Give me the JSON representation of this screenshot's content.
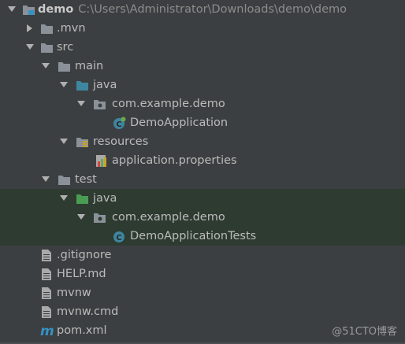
{
  "project": {
    "name": "demo",
    "path": "C:\\Users\\Administrator\\Downloads\\demo\\demo"
  },
  "tree": [
    {
      "label": "demo",
      "icon": "module-folder-icon",
      "expanded": true
    },
    {
      "label": ".mvn",
      "icon": "folder-icon",
      "expanded": false
    },
    {
      "label": "src",
      "icon": "folder-icon",
      "expanded": true
    },
    {
      "label": "main",
      "icon": "folder-icon",
      "expanded": true
    },
    {
      "label": "java",
      "icon": "source-folder-icon",
      "expanded": true
    },
    {
      "label": "com.example.demo",
      "icon": "package-icon",
      "expanded": true
    },
    {
      "label": "DemoApplication",
      "icon": "spring-boot-class-icon"
    },
    {
      "label": "resources",
      "icon": "resources-folder-icon",
      "expanded": true
    },
    {
      "label": "application.properties",
      "icon": "properties-file-icon"
    },
    {
      "label": "test",
      "icon": "folder-icon",
      "expanded": true
    },
    {
      "label": "java",
      "icon": "test-source-folder-icon",
      "expanded": true
    },
    {
      "label": "com.example.demo",
      "icon": "package-icon",
      "expanded": true
    },
    {
      "label": "DemoApplicationTests",
      "icon": "class-icon"
    },
    {
      "label": ".gitignore",
      "icon": "text-file-icon"
    },
    {
      "label": "HELP.md",
      "icon": "text-file-icon"
    },
    {
      "label": "mvnw",
      "icon": "text-file-icon"
    },
    {
      "label": "mvnw.cmd",
      "icon": "text-file-icon"
    },
    {
      "label": "pom.xml",
      "icon": "maven-icon"
    }
  ],
  "colors": {
    "background": "#3c3f41",
    "test_highlight": "#2e3b30",
    "folder": "#8a9199",
    "source_folder": "#3e86a0",
    "test_folder": "#499c54",
    "class": "#3e86a0",
    "maven": "#3592c4"
  },
  "watermark": "@51CTO博客"
}
